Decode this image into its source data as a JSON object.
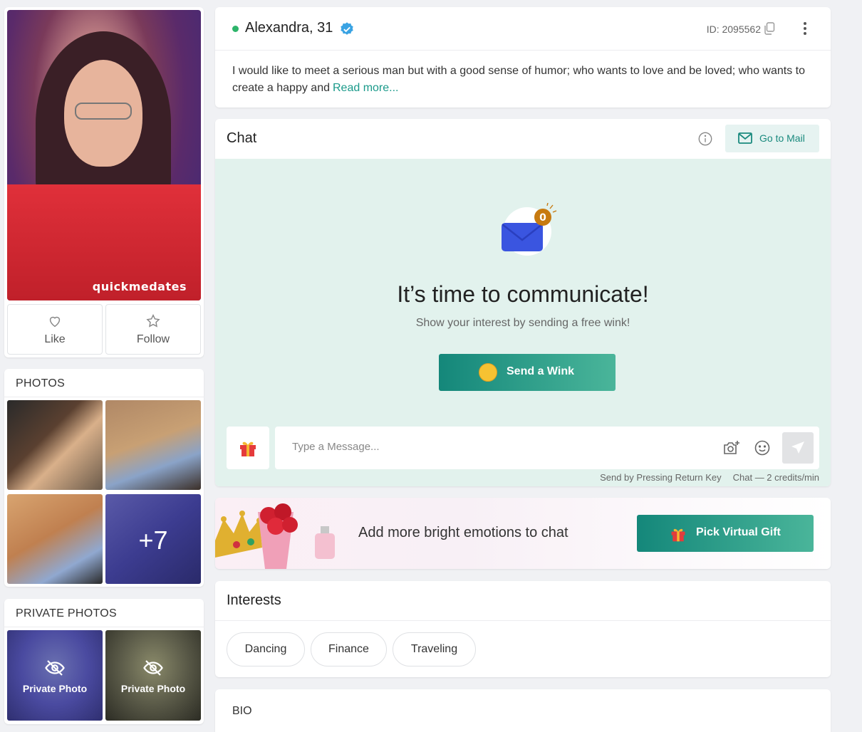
{
  "profile": {
    "watermark": "quickmedates",
    "like_label": "Like",
    "follow_label": "Follow"
  },
  "photos": {
    "heading": "PHOTOS",
    "more_count": "+7"
  },
  "private_photos": {
    "heading": "PRIVATE PHOTOS",
    "items": [
      {
        "label": "Private Photo"
      },
      {
        "label": "Private Photo"
      }
    ]
  },
  "header": {
    "name": "Alexandra, 31",
    "online": true,
    "user_id": "ID: 2095562",
    "about": "I would like to meet a serious man but with a good sense of humor; who wants to love and be loved; who wants to create a happy and",
    "read_more": "Read more..."
  },
  "chat": {
    "title": "Chat",
    "mail_button": "Go to Mail",
    "unread_count": "0",
    "headline": "It’s time to communicate!",
    "subtext": "Show your interest by sending a free wink!",
    "wink_button": "Send a Wink",
    "input_placeholder": "Type a Message...",
    "footer_hint": "Send by Pressing Return Key",
    "footer_rate": "Chat — 2 credits/min"
  },
  "gift_banner": {
    "text": "Add more bright emotions to chat",
    "button": "Pick Virtual Gift"
  },
  "interests": {
    "title": "Interests",
    "items": [
      "Dancing",
      "Finance",
      "Traveling"
    ]
  },
  "bio": {
    "title": "BIO"
  },
  "colors": {
    "accent": "#14877a",
    "online": "#2db46a",
    "verified": "#3aa3e3",
    "chat_bg": "#e2f2ed"
  }
}
